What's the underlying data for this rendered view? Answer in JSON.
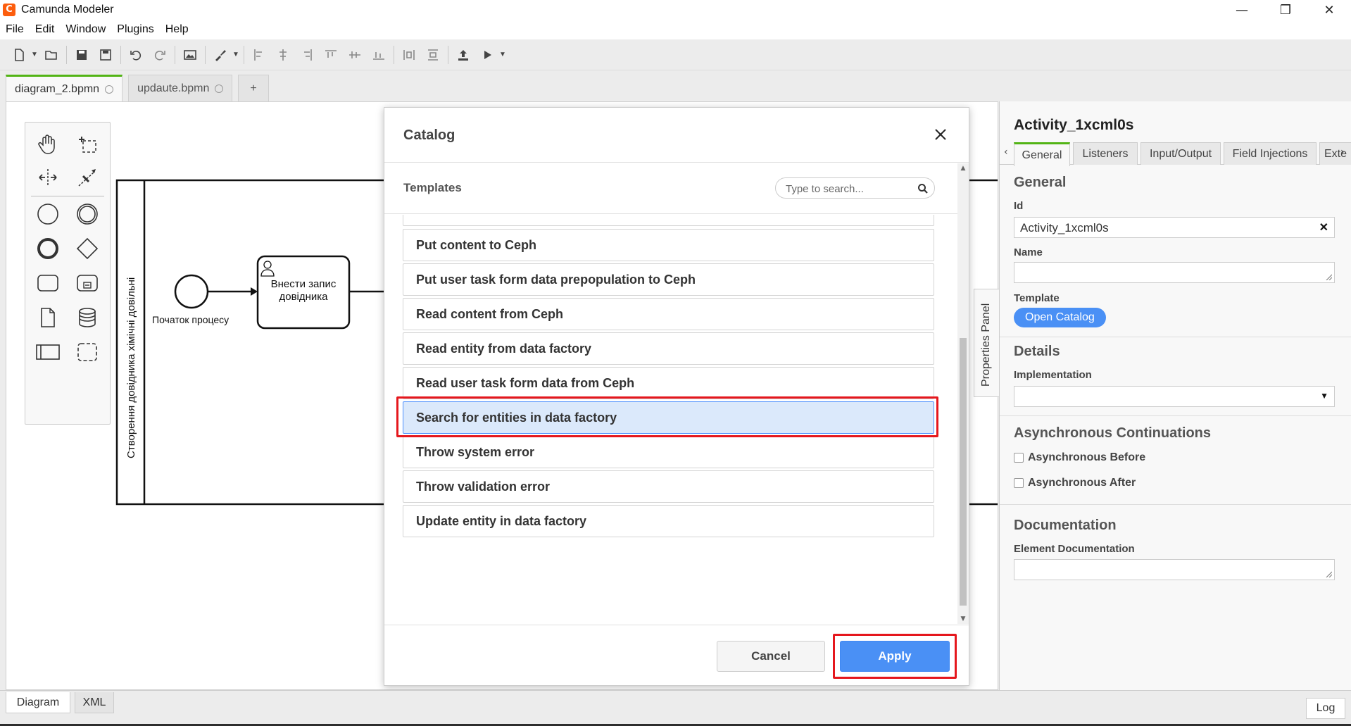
{
  "window": {
    "title": "Camunda Modeler",
    "app_icon": "C",
    "controls": [
      "—",
      "❐",
      "✕"
    ]
  },
  "menu": [
    "File",
    "Edit",
    "Window",
    "Plugins",
    "Help"
  ],
  "tabs": [
    {
      "label": "diagram_2.bpmn",
      "active": true
    },
    {
      "label": "updaute.bpmn",
      "active": false
    },
    {
      "label": "+"
    }
  ],
  "diagram": {
    "pool_label": "Створення довідника хімічні довільні",
    "start_event_label": "Початок процесу",
    "task_label_line1": "Внести запис",
    "task_label_line2": "довідника"
  },
  "catalog": {
    "title": "Catalog",
    "templates_label": "Templates",
    "search_placeholder": "Type to search...",
    "items": [
      {
        "label": "Put content to Ceph",
        "selected": false
      },
      {
        "label": "Put user task form data prepopulation to Ceph",
        "selected": false
      },
      {
        "label": "Read content from Ceph",
        "selected": false
      },
      {
        "label": "Read entity from data factory",
        "selected": false
      },
      {
        "label": "Read user task form data from Ceph",
        "selected": false
      },
      {
        "label": "Search for entities in data factory",
        "selected": true
      },
      {
        "label": "Throw system error",
        "selected": false
      },
      {
        "label": "Throw validation error",
        "selected": false
      },
      {
        "label": "Update entity in data factory",
        "selected": false
      }
    ],
    "cancel_label": "Cancel",
    "apply_label": "Apply"
  },
  "properties": {
    "toggle_label": "Properties Panel",
    "element_title": "Activity_1xcml0s",
    "tabs": [
      "General",
      "Listeners",
      "Input/Output",
      "Field Injections",
      "Exte"
    ],
    "general_heading": "General",
    "id_label": "Id",
    "id_value": "Activity_1xcml0s",
    "name_label": "Name",
    "template_label": "Template",
    "open_catalog_label": "Open Catalog",
    "details_heading": "Details",
    "implementation_label": "Implementation",
    "async_heading": "Asynchronous Continuations",
    "async_before_label": "Asynchronous Before",
    "async_after_label": "Asynchronous After",
    "documentation_heading": "Documentation",
    "element_doc_label": "Element Documentation"
  },
  "bottom": {
    "diagram_tab": "Diagram",
    "xml_tab": "XML",
    "log_label": "Log"
  },
  "colors": {
    "accent": "#4a90f5",
    "highlight": "#e5171d",
    "tab_active": "#52b415",
    "app_icon": "#fc5d0d"
  }
}
